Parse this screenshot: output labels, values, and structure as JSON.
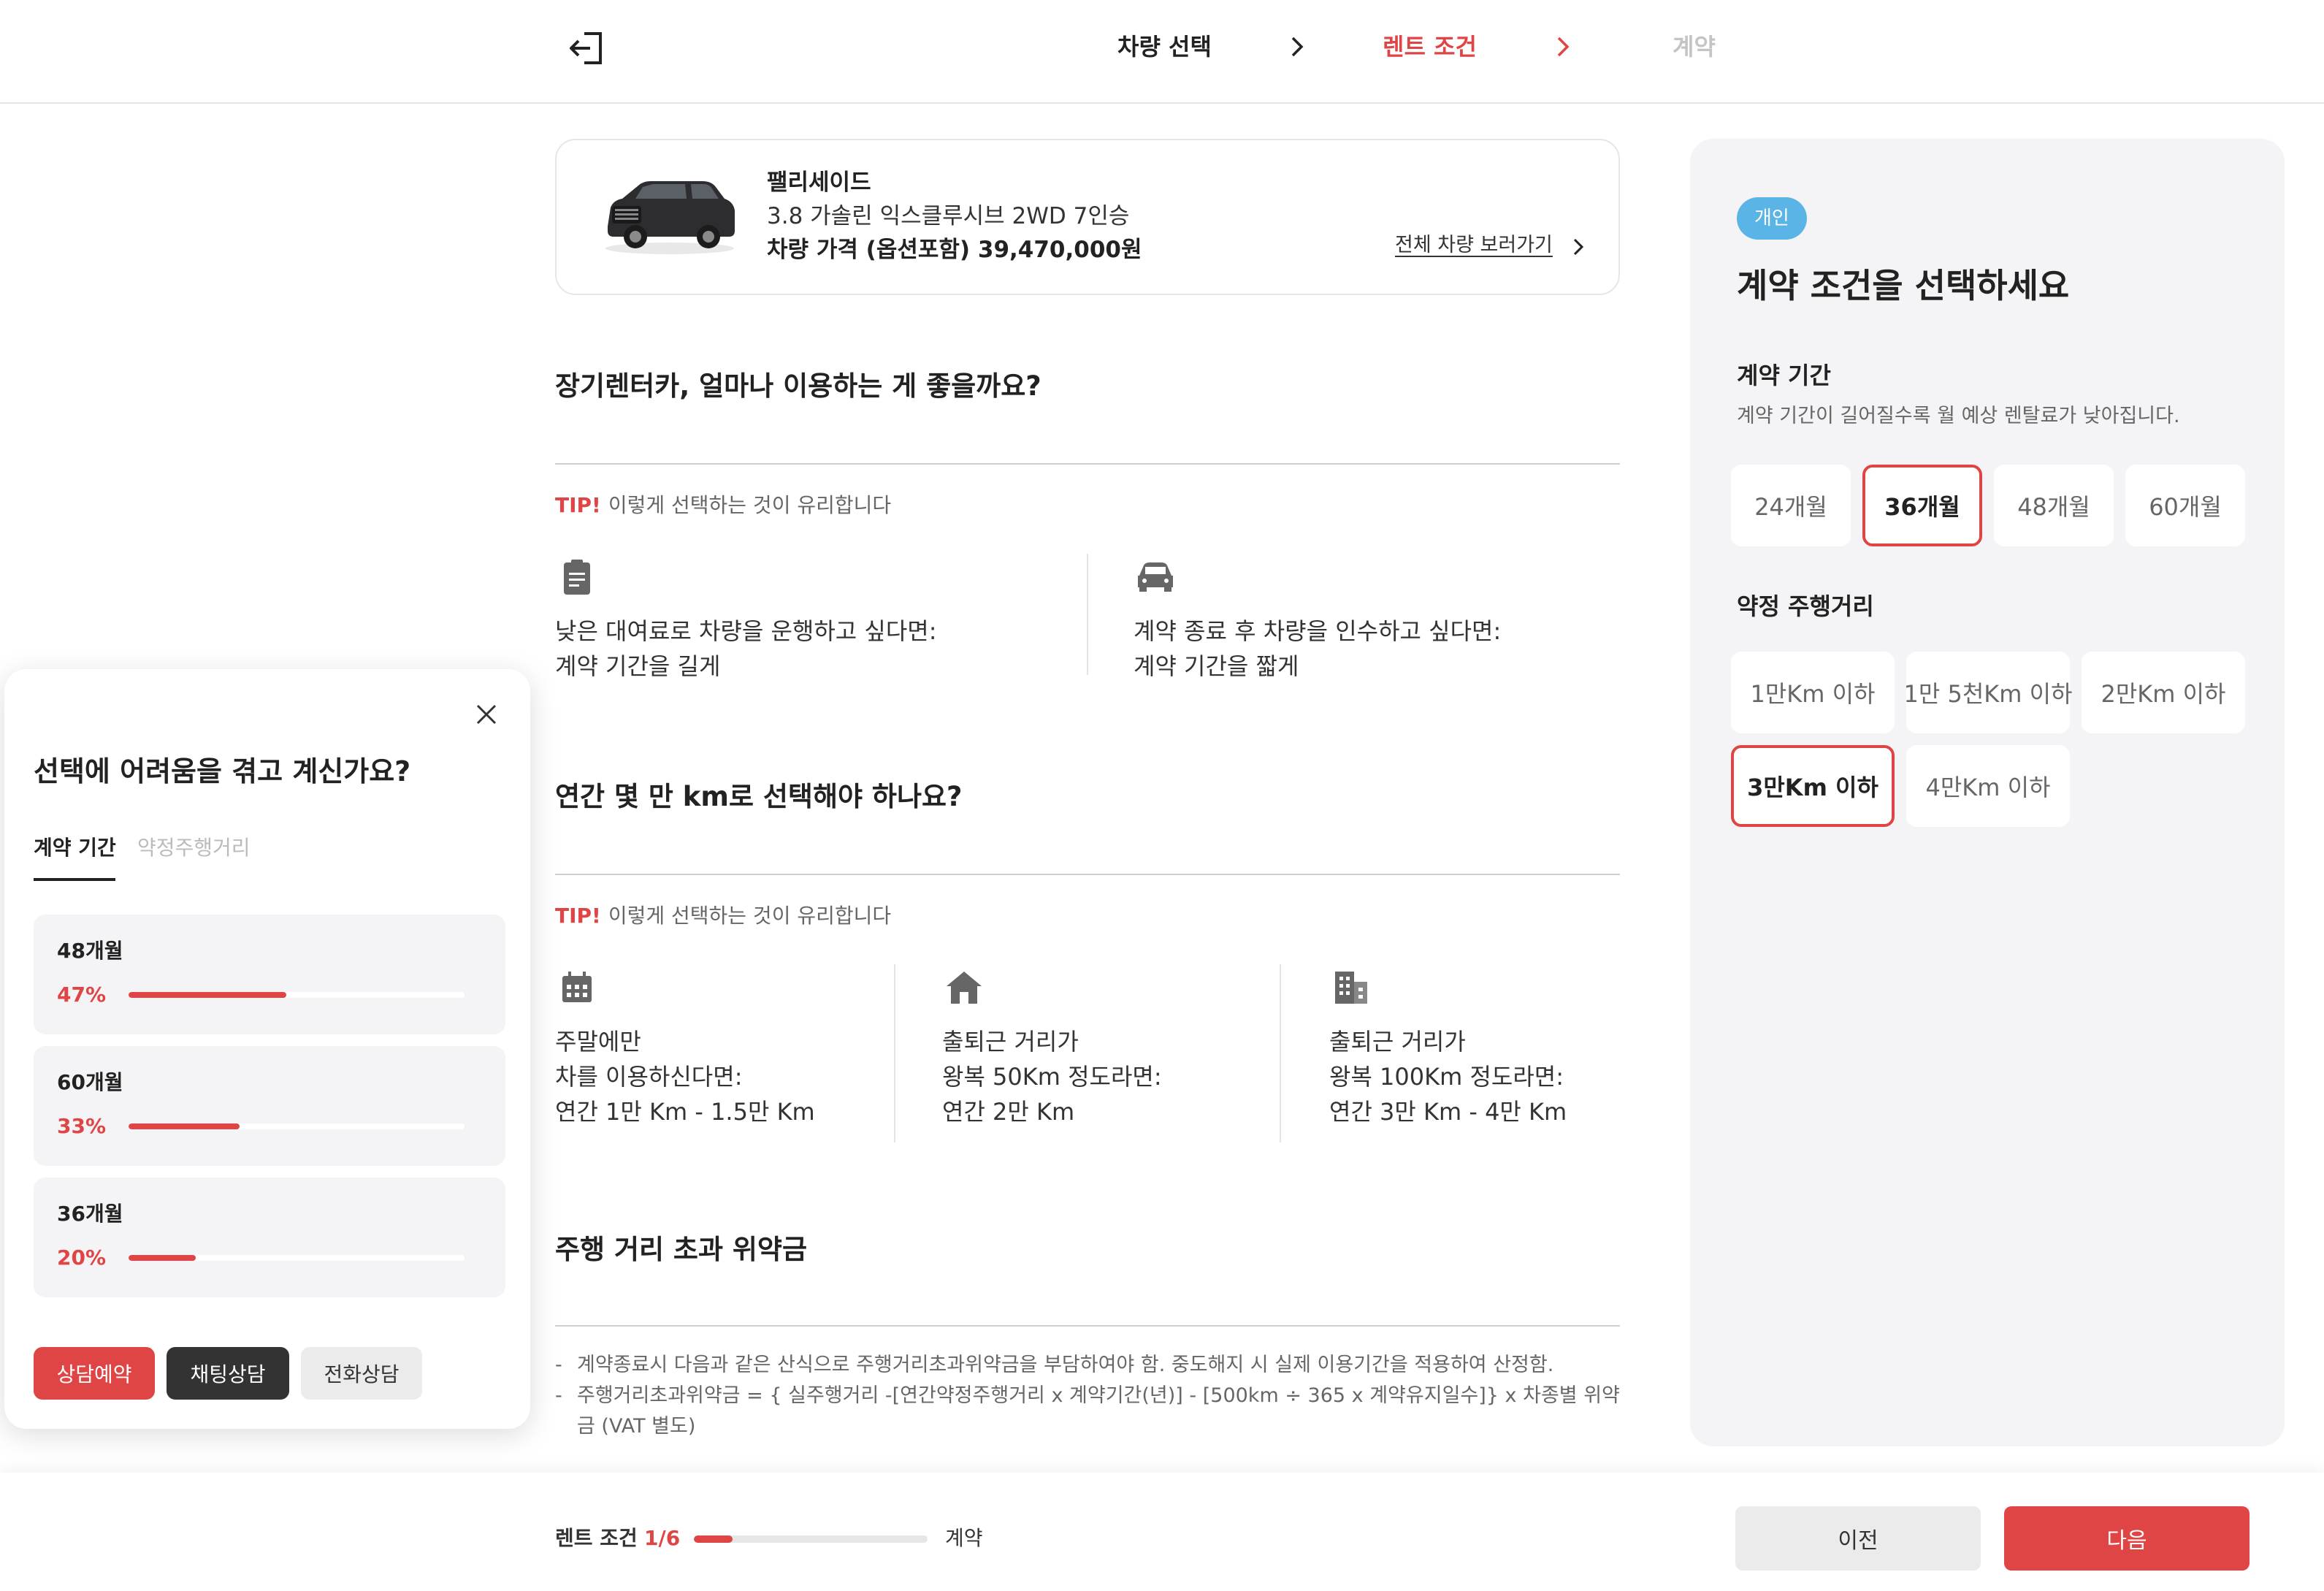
{
  "header": {
    "steps": [
      "차량 선택",
      "렌트 조건",
      "계약"
    ],
    "active_step_color": "#e04545"
  },
  "car": {
    "name": "팰리세이드",
    "trim": "3.8 가솔린 익스클루시브 2WD 7인승",
    "price": "차량 가격 (옵션포함) 39,470,000원",
    "all_cars_link": "전체 차량 보러가기"
  },
  "section1": {
    "title": "장기렌터카, 얼마나 이용하는 게 좋을까요?",
    "tip_label": "TIP!",
    "tip_text": "이렇게 선택하는 것이 유리합니다",
    "items": [
      {
        "icon": "clipboard-icon",
        "line1": "낮은 대여료로 차량을 운행하고 싶다면:",
        "line2": "계약 기간을 길게"
      },
      {
        "icon": "car-icon",
        "line1": "계약 종료 후 차량을 인수하고 싶다면:",
        "line2": "계약 기간을 짧게"
      }
    ]
  },
  "section2": {
    "title": "연간 몇 만 km로 선택해야 하나요?",
    "tip_label": "TIP!",
    "tip_text": "이렇게 선택하는 것이 유리합니다",
    "items": [
      {
        "icon": "calendar-icon",
        "line1": "주말에만",
        "line2": "차를 이용하신다면:",
        "line3": "연간 1만 Km - 1.5만 Km"
      },
      {
        "icon": "house-icon",
        "line1": "출퇴근 거리가",
        "line2": "왕복 50Km 정도라면:",
        "line3": "연간 2만 Km"
      },
      {
        "icon": "building-icon",
        "line1": "출퇴근 거리가",
        "line2": "왕복 100Km 정도라면:",
        "line3": "연간 3만 Km - 4만 Km"
      }
    ]
  },
  "section3": {
    "title": "주행 거리 초과 위약금",
    "notes": [
      "계약종료시 다음과 같은 산식으로 주행거리초과위약금을 부담하여야 함. 중도해지 시 실제 이용기간을 적용하여 산정함.",
      "주행거리초과위약금 = { 실주행거리 -[연간약정주행거리 x 계약기간(년)] - [500km ÷ 365 x 계약유지일수]} x 차종별 위약금 (VAT 별도)"
    ]
  },
  "panel": {
    "badge": "개인",
    "title": "계약 조건을 선택하세요",
    "period_label": "계약 기간",
    "period_desc": "계약 기간이 길어질수록 월 예상 렌탈료가 낮아집니다.",
    "period_options": [
      "24개월",
      "36개월",
      "48개월",
      "60개월"
    ],
    "period_selected": "36개월",
    "mileage_label": "약정 주행거리",
    "mileage_options": [
      "1만Km 이하",
      "1만 5천Km 이하",
      "2만Km 이하",
      "3만Km 이하",
      "4만Km 이하"
    ],
    "mileage_selected": "3만Km 이하"
  },
  "popup": {
    "title": "선택에 어려움을 겪고 계신가요?",
    "tabs": [
      "계약 기간",
      "약정주행거리"
    ],
    "active_tab": "계약 기간",
    "stats": [
      {
        "label": "48개월",
        "percent_text": "47%",
        "percent": 47
      },
      {
        "label": "60개월",
        "percent_text": "33%",
        "percent": 33
      },
      {
        "label": "36개월",
        "percent_text": "20%",
        "percent": 20
      }
    ],
    "buttons": [
      "상담예약",
      "채팅상담",
      "전화상담"
    ]
  },
  "footer": {
    "current_label": "렌트 조건",
    "step_text": "1/6",
    "progress_fraction": 0.1667,
    "next_label": "계약",
    "prev_button": "이전",
    "next_button": "다음"
  }
}
